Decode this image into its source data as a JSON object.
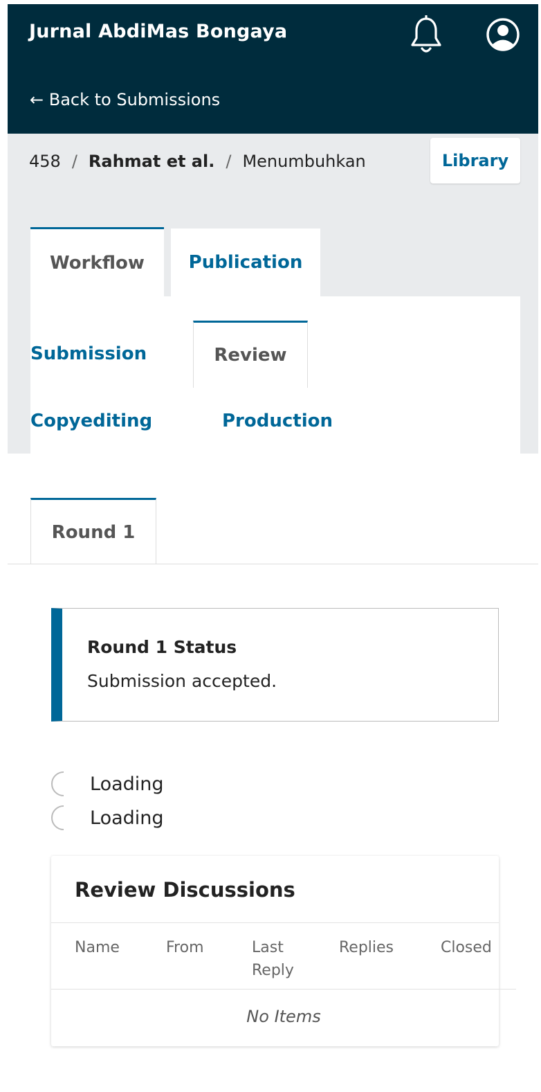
{
  "header": {
    "app_title": "Jurnal AbdiMas Bongaya",
    "back_link": "← Back to Submissions",
    "icons": [
      "bell-icon",
      "user-account-icon"
    ]
  },
  "breadcrumb": {
    "id": "458",
    "authors": "Rahmat et al.",
    "title": "Menumbuhkan",
    "separator": "/"
  },
  "library_button": "Library",
  "main_tabs": [
    {
      "label": "Workflow",
      "active": true
    },
    {
      "label": "Publication",
      "active": false
    }
  ],
  "stage_tabs": [
    {
      "label": "Submission",
      "active": false
    },
    {
      "label": "Review",
      "active": true
    },
    {
      "label": "Copyediting",
      "active": false
    },
    {
      "label": "Production",
      "active": false
    }
  ],
  "round_tab": "Round 1",
  "status": {
    "title": "Round 1 Status",
    "text": "Submission accepted."
  },
  "loading": [
    "Loading",
    "Loading"
  ],
  "discussions": {
    "title": "Review Discussions",
    "columns": [
      "Name",
      "From",
      "Last Reply",
      "Replies",
      "Closed"
    ],
    "empty_text": "No Items"
  },
  "colors": {
    "header_bg": "#002c3d",
    "accent": "#006798",
    "grey_band": "#e9ebed"
  }
}
